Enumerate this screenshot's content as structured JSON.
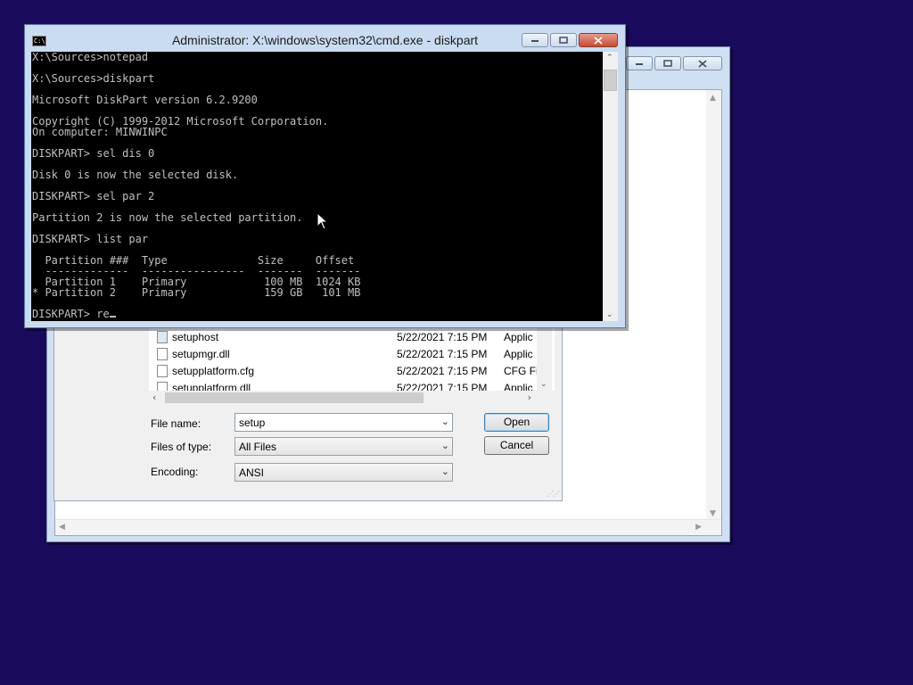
{
  "cmd": {
    "title": "Administrator: X:\\windows\\system32\\cmd.exe - diskpart",
    "icon": "cmd-icon",
    "icon_text": "C:\\.",
    "lines": [
      "X:\\Sources>notepad",
      "",
      "X:\\Sources>diskpart",
      "",
      "Microsoft DiskPart version 6.2.9200",
      "",
      "Copyright (C) 1999-2012 Microsoft Corporation.",
      "On computer: MINWINPC",
      "",
      "DISKPART> sel dis 0",
      "",
      "Disk 0 is now the selected disk.",
      "",
      "DISKPART> sel par 2",
      "",
      "Partition 2 is now the selected partition.",
      "",
      "DISKPART> list par",
      "",
      "  Partition ###  Type              Size     Offset",
      "  -------------  ----------------  -------  -------",
      "  Partition 1    Primary            100 MB  1024 KB",
      "* Partition 2    Primary            159 GB   101 MB",
      "",
      "DISKPART> re"
    ]
  },
  "dialog": {
    "files": [
      {
        "name": "setuphost",
        "date": "5/22/2021 7:15 PM",
        "type": "Applic",
        "icon": "exe-icon"
      },
      {
        "name": "setupmgr.dll",
        "date": "5/22/2021 7:15 PM",
        "type": "Applic",
        "icon": "dll-icon"
      },
      {
        "name": "setupplatform.cfg",
        "date": "5/22/2021 7:15 PM",
        "type": "CFG Fi",
        "icon": "file-icon"
      },
      {
        "name": "setupplatform.dll",
        "date": "5/22/2021 7:15 PM",
        "type": "Applic",
        "icon": "dll-icon"
      }
    ],
    "file_name_label": "File name:",
    "file_name_value": "setup",
    "files_of_type_label": "Files of type:",
    "files_of_type_value": "All Files",
    "encoding_label": "Encoding:",
    "encoding_value": "ANSI",
    "open_label": "Open",
    "cancel_label": "Cancel"
  },
  "colors": {
    "desktop": "#190a5c",
    "console_bg": "#000000",
    "console_fg": "#c0c0c0",
    "close_red": "#c64c36"
  }
}
